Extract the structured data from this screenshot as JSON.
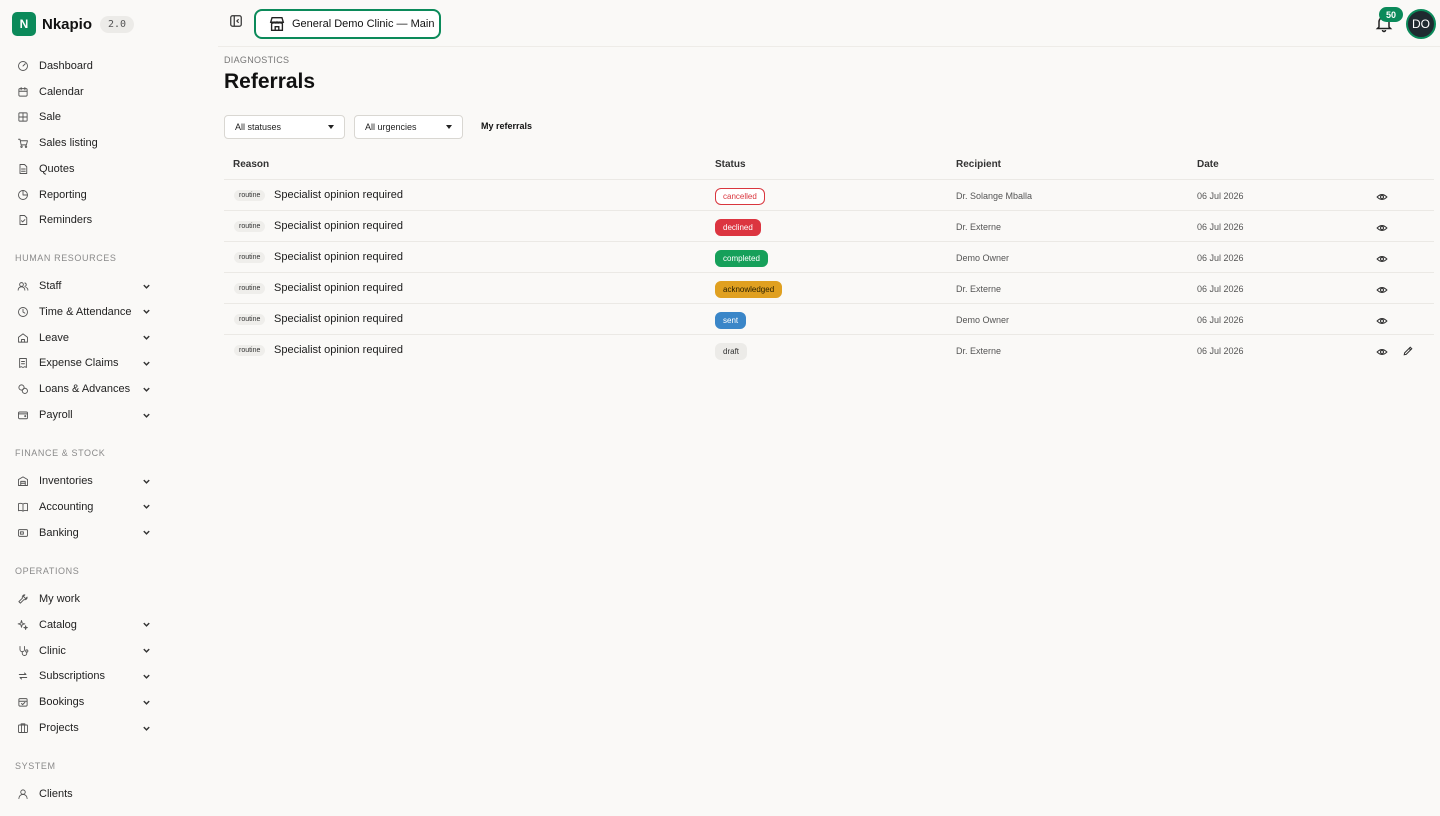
{
  "app": {
    "name": "Nkapio",
    "version": "2.0"
  },
  "sidebar": {
    "top_items": [
      {
        "label": "Dashboard",
        "icon": "dashboard-icon"
      },
      {
        "label": "Calendar",
        "icon": "calendar-icon"
      },
      {
        "label": "Sale",
        "icon": "sale-icon"
      },
      {
        "label": "Sales listing",
        "icon": "cart-icon"
      },
      {
        "label": "Quotes",
        "icon": "document-icon"
      },
      {
        "label": "Reporting",
        "icon": "chart-icon"
      },
      {
        "label": "Reminders",
        "icon": "reminder-icon"
      }
    ],
    "sections": [
      {
        "title": "HUMAN RESOURCES",
        "items": [
          {
            "label": "Staff",
            "icon": "users-icon"
          },
          {
            "label": "Time & Attendance",
            "icon": "clock-icon"
          },
          {
            "label": "Leave",
            "icon": "leave-icon"
          },
          {
            "label": "Expense Claims",
            "icon": "receipt-icon"
          },
          {
            "label": "Loans & Advances",
            "icon": "coins-icon"
          },
          {
            "label": "Payroll",
            "icon": "wallet-icon"
          }
        ]
      },
      {
        "title": "FINANCE & STOCK",
        "items": [
          {
            "label": "Inventories",
            "icon": "warehouse-icon"
          },
          {
            "label": "Accounting",
            "icon": "book-icon"
          },
          {
            "label": "Banking",
            "icon": "bank-card-icon"
          }
        ]
      },
      {
        "title": "OPERATIONS",
        "items": [
          {
            "label": "My work",
            "icon": "wrench-icon"
          },
          {
            "label": "Catalog",
            "icon": "sparkles-icon"
          },
          {
            "label": "Clinic",
            "icon": "stethoscope-icon"
          },
          {
            "label": "Subscriptions",
            "icon": "repeat-icon"
          },
          {
            "label": "Bookings",
            "icon": "calendar-check-icon"
          },
          {
            "label": "Projects",
            "icon": "projects-icon"
          }
        ]
      },
      {
        "title": "SYSTEM",
        "items": [
          {
            "label": "Clients",
            "icon": "user-icon"
          }
        ]
      }
    ]
  },
  "topbar": {
    "clinic_label": "General Demo Clinic — Main",
    "notification_count": "50",
    "avatar_initials": "DO"
  },
  "page": {
    "breadcrumb": "DIAGNOSTICS",
    "title": "Referrals",
    "filters": {
      "status": "All statuses",
      "urgency": "All urgencies",
      "my_referrals": "My referrals"
    }
  },
  "table": {
    "columns": [
      "Reason",
      "Status",
      "Recipient",
      "Date"
    ],
    "rows": [
      {
        "urgency": "routine",
        "reason": "Specialist opinion required",
        "status": "cancelled",
        "recipient": "Dr. Solange Mballa",
        "date": "06 Jul 2026",
        "editable": false
      },
      {
        "urgency": "routine",
        "reason": "Specialist opinion required",
        "status": "declined",
        "recipient": "Dr. Externe",
        "date": "06 Jul 2026",
        "editable": false
      },
      {
        "urgency": "routine",
        "reason": "Specialist opinion required",
        "status": "completed",
        "recipient": "Demo Owner",
        "date": "06 Jul 2026",
        "editable": false
      },
      {
        "urgency": "routine",
        "reason": "Specialist opinion required",
        "status": "acknowledged",
        "recipient": "Dr. Externe",
        "date": "06 Jul 2026",
        "editable": false
      },
      {
        "urgency": "routine",
        "reason": "Specialist opinion required",
        "status": "sent",
        "recipient": "Demo Owner",
        "date": "06 Jul 2026",
        "editable": false
      },
      {
        "urgency": "routine",
        "reason": "Specialist opinion required",
        "status": "draft",
        "recipient": "Dr. Externe",
        "date": "06 Jul 2026",
        "editable": true
      }
    ]
  },
  "status_colors": {
    "cancelled": {
      "bg": "#ffffff",
      "fg": "#d9363e",
      "border": "#d9363e"
    },
    "declined": {
      "bg": "#dc3540",
      "fg": "#ffffff",
      "border": "#dc3540"
    },
    "completed": {
      "bg": "#16a05a",
      "fg": "#ffffff",
      "border": "#16a05a"
    },
    "acknowledged": {
      "bg": "#e0a020",
      "fg": "#2a2000",
      "border": "#e0a020"
    },
    "sent": {
      "bg": "#3a86c8",
      "fg": "#ffffff",
      "border": "#3a86c8"
    },
    "draft": {
      "bg": "#ecebe8",
      "fg": "#333333",
      "border": "#ecebe8"
    }
  },
  "accent_color": "#0b8a5a"
}
